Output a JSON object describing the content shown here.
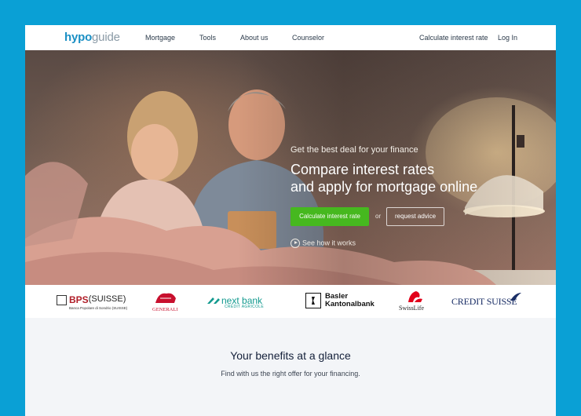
{
  "nav": {
    "logo_part1": "hypo",
    "logo_part2": "guide",
    "links": [
      "Mortgage",
      "Tools",
      "About us",
      "Counselor"
    ],
    "calculate": "Calculate interest rate",
    "login": "Log In"
  },
  "hero": {
    "tagline": "Get the best deal for your finance",
    "headline_line1": "Compare interest rates",
    "headline_line2": "and apply for mortgage online",
    "primary_button": "Calculate interest rate",
    "or": "or",
    "secondary_button": "request advice",
    "how_link": "See how it works"
  },
  "partners": {
    "bps_name": "BPS",
    "bps_name2": "(SUISSE)",
    "bps_sub": "Banca Popolare di Sondrio (SUISSE)",
    "generali": "GENERALI",
    "nextbank": "next bank",
    "nextbank_sub": "CRÉDIT AGRICOLE",
    "bkb_line1": "Basler",
    "bkb_line2": "Kantonalbank",
    "swisslife": "SwissLife",
    "creditsuisse": "CREDIT SUISSE"
  },
  "benefits": {
    "title": "Your benefits at a glance",
    "subtitle": "Find with us the right offer for your financing."
  },
  "colors": {
    "background": "#0aa0d5",
    "primary_button": "#46b81f",
    "logo_accent": "#1a8fc4"
  }
}
